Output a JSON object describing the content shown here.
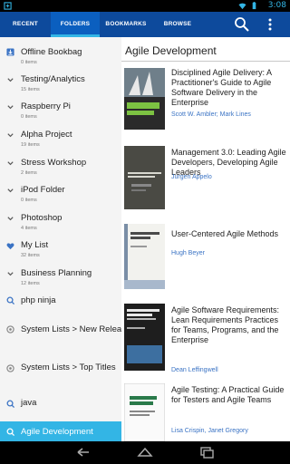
{
  "status": {
    "time": "3:08"
  },
  "tabs": [
    {
      "label": "RECENT"
    },
    {
      "label": "FOLDERS"
    },
    {
      "label": "BOOKMARKS"
    },
    {
      "label": "BROWSE"
    }
  ],
  "sidebar": {
    "items": [
      {
        "name": "Offline Bookbag",
        "count": "0 items",
        "icon": "download-icon"
      },
      {
        "name": "Testing/Analytics",
        "count": "15 items",
        "icon": "chevron-icon"
      },
      {
        "name": "Raspberry Pi",
        "count": "0 items",
        "icon": "chevron-icon"
      },
      {
        "name": "Alpha Project",
        "count": "19 items",
        "icon": "chevron-icon"
      },
      {
        "name": "Stress Workshop",
        "count": "2 items",
        "icon": "chevron-icon"
      },
      {
        "name": "iPod Folder",
        "count": "0 items",
        "icon": "chevron-icon"
      },
      {
        "name": "Photoshop",
        "count": "4 items",
        "icon": "chevron-icon"
      },
      {
        "name": "My List",
        "count": "32 items",
        "icon": "heart-icon"
      },
      {
        "name": "Business Planning",
        "count": "12 items",
        "icon": "chevron-icon"
      },
      {
        "name": "php ninja",
        "count": "",
        "icon": "search-list-icon"
      },
      {
        "name": "System Lists > New Releases",
        "count": "",
        "icon": "gear-list-icon"
      },
      {
        "name": "System Lists > Top Titles",
        "count": "",
        "icon": "gear-list-icon"
      },
      {
        "name": "java",
        "count": "",
        "icon": "search-list-icon"
      },
      {
        "name": "Agile Development",
        "count": "",
        "icon": "search-list-icon"
      }
    ]
  },
  "main": {
    "title": "Agile Development",
    "books": [
      {
        "title": "Disciplined Agile Delivery: A Practitioner's Guide to Agile Software Delivery in the Enterprise",
        "authors": "Scott W. Ambler; Mark Lines",
        "cover_text": "Disciplined Agile Delivery"
      },
      {
        "title": "Management 3.0: Leading Agile Developers, Developing Agile Leaders",
        "authors": "Jurgen Appelo",
        "cover_text": "MANAGEMENT 3.0"
      },
      {
        "title": "User-Centered Agile Methods",
        "authors": "Hugh Beyer",
        "cover_text": "User-Centered Agile Methods"
      },
      {
        "title": "Agile Software Requirements: Lean Requirements Practices for Teams, Programs, and the Enterprise",
        "authors": "Dean Leffingwell",
        "cover_text": "Agile Software Requirements"
      },
      {
        "title": "Agile Testing: A Practical Guide for Testers and Agile Teams",
        "authors": "Lisa Crispin, Janet Gregory",
        "cover_text": "AGILE TESTING"
      }
    ]
  },
  "colors": {
    "actionbar": "#0d4a9c",
    "accent": "#33b5e5",
    "author_link": "#3a73c4"
  }
}
